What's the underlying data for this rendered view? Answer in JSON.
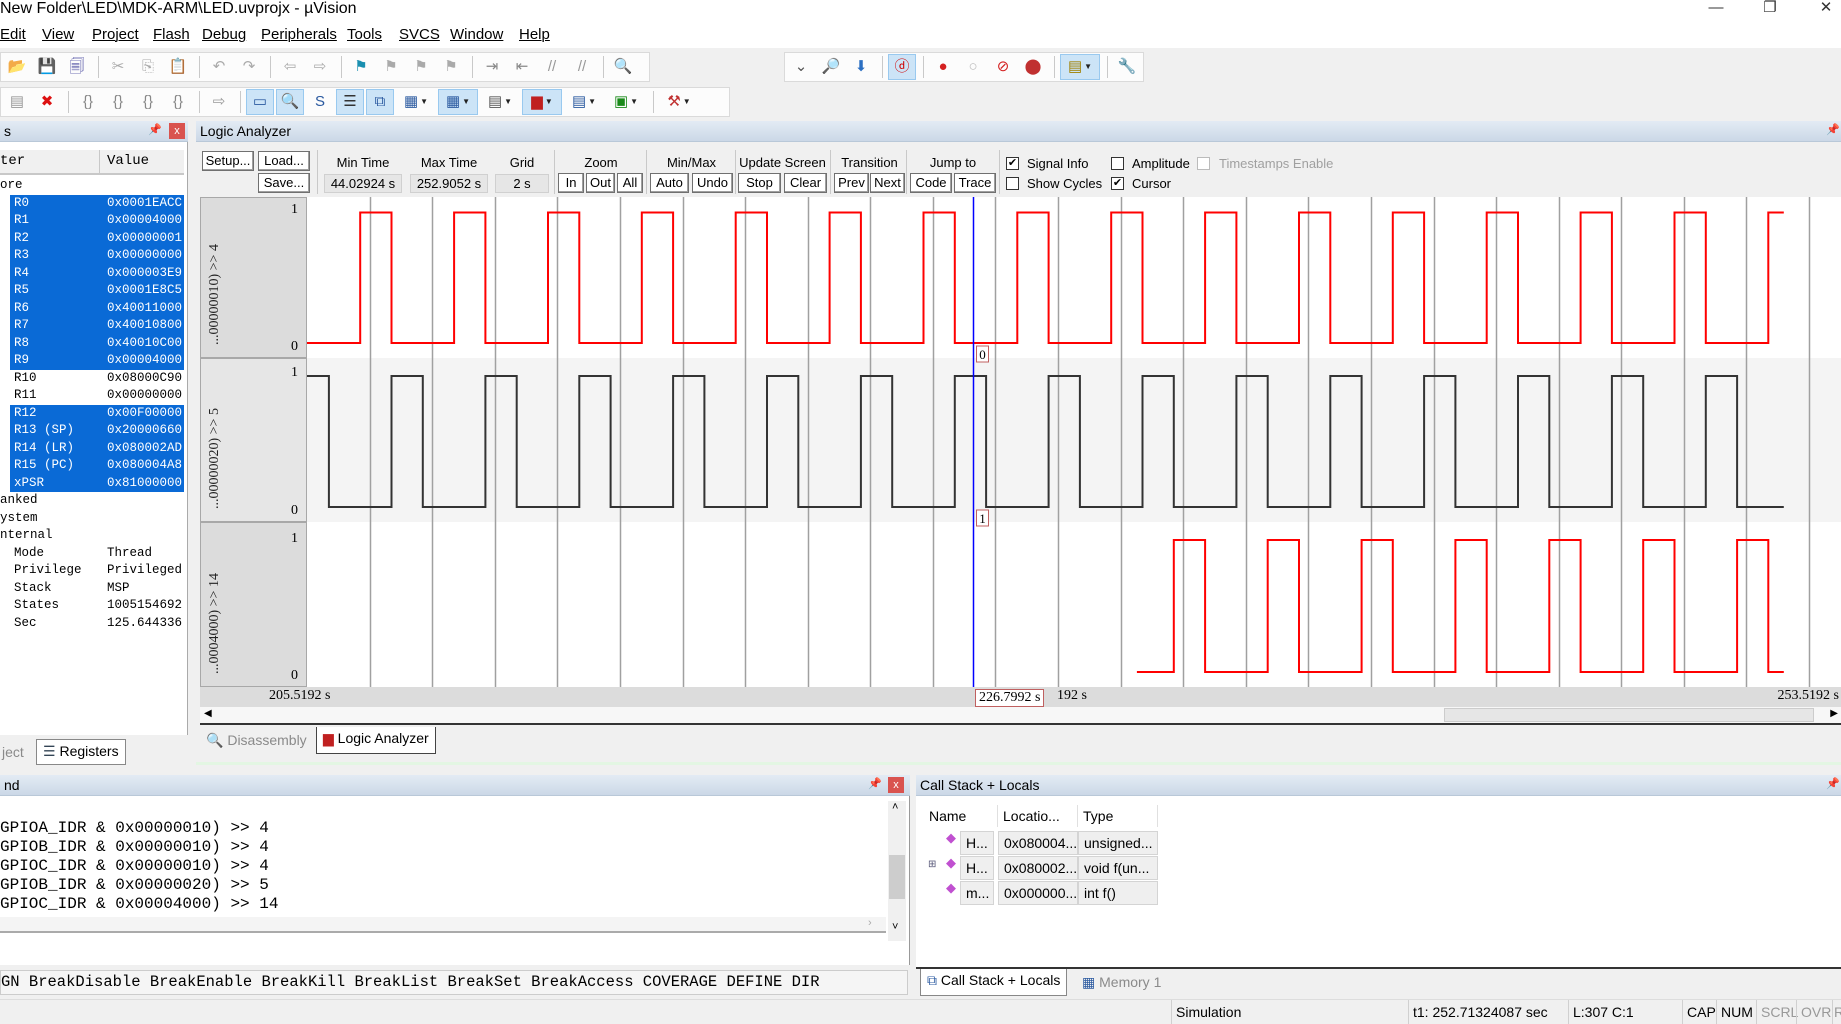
{
  "window": {
    "title": "New Folder\\LED\\MDK-ARM\\LED.uvprojx - µVision",
    "controls": [
      "—",
      "❐",
      "✕"
    ]
  },
  "menu": [
    "Edit",
    "View",
    "Project",
    "Flash",
    "Debug",
    "Peripherals",
    "Tools",
    "SVCS",
    "Window",
    "Help"
  ],
  "toolbar1": [
    {
      "name": "open-icon",
      "glyph": "📂",
      "color": "#d9a400"
    },
    {
      "name": "save-icon",
      "glyph": "💾",
      "color": "#2a55a6"
    },
    {
      "name": "save-all-icon",
      "glyph": "🗐",
      "color": "#4a4aa0"
    },
    {
      "sep": true
    },
    {
      "name": "cut-icon",
      "glyph": "✂",
      "color": "#aaa"
    },
    {
      "name": "copy-icon",
      "glyph": "⎘",
      "color": "#aaa"
    },
    {
      "name": "paste-icon",
      "glyph": "📋",
      "color": "#b08000"
    },
    {
      "sep": true
    },
    {
      "name": "undo-icon",
      "glyph": "↶",
      "color": "#aaa"
    },
    {
      "name": "redo-icon",
      "glyph": "↷",
      "color": "#aaa"
    },
    {
      "sep": true
    },
    {
      "name": "navigate-back-icon",
      "glyph": "⇦",
      "color": "#aaa"
    },
    {
      "name": "navigate-forward-icon",
      "glyph": "⇨",
      "color": "#aaa"
    },
    {
      "sep": true
    },
    {
      "name": "bookmark-icon",
      "glyph": "⚑",
      "color": "#1a8fb0"
    },
    {
      "name": "prev-bookmark-icon",
      "glyph": "⚑",
      "color": "#aaa"
    },
    {
      "name": "next-bookmark-icon",
      "glyph": "⚑",
      "color": "#aaa"
    },
    {
      "name": "clear-bookmarks-icon",
      "glyph": "⚑",
      "color": "#aaa"
    },
    {
      "sep": true
    },
    {
      "name": "indent-icon",
      "glyph": "⇥",
      "color": "#888"
    },
    {
      "name": "unindent-icon",
      "glyph": "⇤",
      "color": "#888"
    },
    {
      "name": "comment-icon",
      "glyph": "//",
      "color": "#999"
    },
    {
      "name": "uncomment-icon",
      "glyph": "//",
      "color": "#999"
    },
    {
      "sep": true
    },
    {
      "name": "find-in-files-icon",
      "glyph": "🔍",
      "color": "#c09000"
    }
  ],
  "toolbar1_right": [
    {
      "name": "find-combo-dropdown-icon",
      "glyph": "⌄",
      "color": "#555"
    },
    {
      "name": "find-icon",
      "glyph": "🔎",
      "color": "#335"
    },
    {
      "name": "incremental-find-icon",
      "glyph": "⬇",
      "color": "#2b6fc2"
    },
    {
      "sep": true
    },
    {
      "name": "start-stop-debug-icon",
      "glyph": "ⓓ",
      "color": "#d00000",
      "hl": true
    },
    {
      "sep": true
    },
    {
      "name": "insert-breakpoint-icon",
      "glyph": "●",
      "color": "#d42020"
    },
    {
      "name": "enable-breakpoint-icon",
      "glyph": "○",
      "color": "#bbb"
    },
    {
      "name": "disable-breakpoints-icon",
      "glyph": "⊘",
      "color": "#d42020"
    },
    {
      "name": "kill-breakpoints-icon",
      "glyph": "⬤",
      "color": "#c03030"
    },
    {
      "sep": true
    },
    {
      "name": "window-layout-icon",
      "glyph": "▤",
      "color": "#a08000",
      "hl": true,
      "dropdown": true
    },
    {
      "sep": true
    },
    {
      "name": "configure-icon",
      "glyph": "🔧",
      "color": "#3a6ea5"
    }
  ],
  "toolbar2": [
    {
      "name": "reset-icon",
      "glyph": "▤",
      "color": "#999"
    },
    {
      "name": "stop-icon",
      "glyph": "✖",
      "color": "#d11"
    },
    {
      "sep": true
    },
    {
      "name": "step-into-icon",
      "glyph": "{}",
      "color": "#888"
    },
    {
      "name": "step-over-icon",
      "glyph": "{}",
      "color": "#888"
    },
    {
      "name": "step-out-icon",
      "glyph": "{}",
      "color": "#888"
    },
    {
      "name": "run-to-cursor-icon",
      "glyph": "{}",
      "color": "#888"
    },
    {
      "sep": true
    },
    {
      "name": "show-next-statement-icon",
      "glyph": "⇨",
      "color": "#999"
    },
    {
      "sep": true
    },
    {
      "name": "command-window-icon",
      "glyph": "▭",
      "color": "#2b5aa0",
      "hl": true
    },
    {
      "name": "disassembly-window-icon",
      "glyph": "🔍",
      "color": "#333",
      "hl": true
    },
    {
      "name": "symbols-window-icon",
      "glyph": "S",
      "color": "#2b5aa0"
    },
    {
      "name": "registers-window-icon",
      "glyph": "☰",
      "color": "#333",
      "hl": true
    },
    {
      "name": "call-stack-window-icon",
      "glyph": "⧉",
      "color": "#2b5aa0",
      "hl": true
    },
    {
      "name": "watch-windows-icon",
      "glyph": "▦",
      "color": "#2b5aa0",
      "dropdown": true
    },
    {
      "name": "memory-windows-icon",
      "glyph": "▦",
      "color": "#2b5aa0",
      "hl": true,
      "dropdown": true
    },
    {
      "name": "serial-windows-icon",
      "glyph": "▤",
      "color": "#555",
      "dropdown": true
    },
    {
      "name": "analysis-windows-icon",
      "glyph": "▆",
      "color": "#c02020",
      "hl": true,
      "dropdown": true
    },
    {
      "name": "trace-windows-icon",
      "glyph": "▤",
      "color": "#2b5aa0",
      "dropdown": true
    },
    {
      "name": "system-viewer-icon",
      "glyph": "▣",
      "color": "#1a8a1a",
      "dropdown": true
    },
    {
      "sep": true
    },
    {
      "name": "toolbox-icon",
      "glyph": "⚒",
      "color": "#c03030",
      "dropdown": true
    }
  ],
  "registers": {
    "title": "s",
    "col_name": "ter",
    "col_value": "Value",
    "rows": [
      {
        "name": "ore",
        "value": "",
        "level": 0
      },
      {
        "name": "R0",
        "value": "0x0001EACC",
        "level": 1,
        "hl": true
      },
      {
        "name": "R1",
        "value": "0x00004000",
        "level": 1,
        "hl": true
      },
      {
        "name": "R2",
        "value": "0x00000001",
        "level": 1,
        "hl": true
      },
      {
        "name": "R3",
        "value": "0x00000000",
        "level": 1,
        "hl": true
      },
      {
        "name": "R4",
        "value": "0x000003E9",
        "level": 1,
        "hl": true
      },
      {
        "name": "R5",
        "value": "0x0001E8C5",
        "level": 1,
        "hl": true
      },
      {
        "name": "R6",
        "value": "0x40011000",
        "level": 1,
        "hl": true
      },
      {
        "name": "R7",
        "value": "0x40010800",
        "level": 1,
        "hl": true
      },
      {
        "name": "R8",
        "value": "0x40010C00",
        "level": 1,
        "hl": true
      },
      {
        "name": "R9",
        "value": "0x00004000",
        "level": 1,
        "hl": true
      },
      {
        "name": "R10",
        "value": "0x08000C90",
        "level": 1
      },
      {
        "name": "R11",
        "value": "0x00000000",
        "level": 1
      },
      {
        "name": "R12",
        "value": "0x00F00000",
        "level": 1,
        "hl": true
      },
      {
        "name": "R13 (SP)",
        "value": "0x20000660",
        "level": 1,
        "hl": true
      },
      {
        "name": "R14 (LR)",
        "value": "0x080002AD",
        "level": 1,
        "hl": true
      },
      {
        "name": "R15 (PC)",
        "value": "0x080004A8",
        "level": 1,
        "hl": true
      },
      {
        "name": "xPSR",
        "value": "0x81000000",
        "level": 1,
        "hl": true
      },
      {
        "name": "anked",
        "value": "",
        "level": 0
      },
      {
        "name": "ystem",
        "value": "",
        "level": 0
      },
      {
        "name": "nternal",
        "value": "",
        "level": 0
      },
      {
        "name": "Mode",
        "value": "Thread",
        "level": 1
      },
      {
        "name": "Privilege",
        "value": "Privileged",
        "level": 1
      },
      {
        "name": "Stack",
        "value": "MSP",
        "level": 1
      },
      {
        "name": "States",
        "value": "1005154692",
        "level": 1
      },
      {
        "name": "Sec",
        "value": "125.644336",
        "level": 1
      }
    ],
    "tabs": [
      {
        "label": "ject"
      },
      {
        "label": "Registers",
        "icon": "registers-icon"
      }
    ]
  },
  "logic_analyzer": {
    "title": "Logic Analyzer",
    "setup": "Setup...",
    "load": "Load...",
    "save": "Save...",
    "min_time_label": "Min Time",
    "min_time": "44.02924 s",
    "max_time_label": "Max Time",
    "max_time": "252.9052 s",
    "grid_label": "Grid",
    "grid": "2 s",
    "zoom_label": "Zoom",
    "zoom_in": "In",
    "zoom_out": "Out",
    "zoom_all": "All",
    "minmax_label": "Min/Max",
    "auto": "Auto",
    "undo": "Undo",
    "update_label": "Update Screen",
    "stop": "Stop",
    "clear": "Clear",
    "transition_label": "Transition",
    "prev": "Prev",
    "next": "Next",
    "jump_label": "Jump to",
    "code": "Code",
    "trace": "Trace",
    "signal_info": {
      "label": "Signal Info",
      "checked": true
    },
    "show_cycles": {
      "label": "Show Cycles",
      "checked": false
    },
    "amplitude": {
      "label": "Amplitude",
      "checked": false
    },
    "cursor": {
      "label": "Cursor",
      "checked": true
    },
    "timestamps": {
      "label": "Timestamps Enable",
      "checked": false,
      "disabled": true
    },
    "time_left": "205.5192 s",
    "time_right": "253.5192 s",
    "cursor_time": "226.7992 s",
    "hidden_time_tail": "192 s",
    "tabs": [
      {
        "label": "Disassembly",
        "icon": "disassembly-icon"
      },
      {
        "label": "Logic Analyzer",
        "icon": "logic-analyzer-icon"
      }
    ]
  },
  "chart_data": {
    "type": "line",
    "xlim": [
      205.5192,
      253.5192
    ],
    "grid_step": 2,
    "grid": true,
    "cursor": 226.7992,
    "signals": [
      {
        "label": "...00000010) >> 4",
        "color": "#ff0000",
        "ymax": "1",
        "ymin": "0",
        "cursor_value": "0",
        "start": 205.5192,
        "end": 252.7132,
        "high_intervals": [
          [
            207.22,
            208.22
          ],
          [
            210.22,
            211.22
          ],
          [
            213.22,
            214.22
          ],
          [
            216.22,
            217.22
          ],
          [
            219.22,
            220.22
          ],
          [
            222.22,
            223.22
          ],
          [
            225.22,
            226.22
          ],
          [
            228.22,
            229.22
          ],
          [
            231.22,
            232.22
          ],
          [
            234.22,
            235.22
          ],
          [
            237.22,
            238.22
          ],
          [
            240.22,
            241.22
          ],
          [
            243.22,
            244.22
          ],
          [
            246.22,
            247.22
          ],
          [
            249.22,
            250.22
          ],
          [
            252.22,
            252.7132
          ]
        ]
      },
      {
        "label": "...00000020) >> 5",
        "color": "#333333",
        "ymax": "1",
        "ymin": "0",
        "cursor_value": "1",
        "start": 205.5192,
        "end": 252.7132,
        "high_intervals": [
          [
            205.5192,
            206.22
          ],
          [
            208.22,
            209.22
          ],
          [
            211.22,
            212.22
          ],
          [
            214.22,
            215.22
          ],
          [
            217.22,
            218.22
          ],
          [
            220.22,
            221.22
          ],
          [
            223.22,
            224.22
          ],
          [
            226.22,
            227.22
          ],
          [
            229.22,
            230.22
          ],
          [
            232.22,
            233.22
          ],
          [
            235.22,
            236.22
          ],
          [
            238.22,
            239.22
          ],
          [
            241.22,
            242.22
          ],
          [
            244.22,
            245.22
          ],
          [
            247.22,
            248.22
          ],
          [
            250.22,
            251.22
          ]
        ]
      },
      {
        "label": "...0004000) >> 14",
        "color": "#ff0000",
        "ymax": "1",
        "ymin": "0",
        "start": 232.04,
        "end": 252.7132,
        "high_intervals": [
          [
            233.22,
            234.22
          ],
          [
            236.22,
            237.22
          ],
          [
            239.22,
            240.22
          ],
          [
            242.22,
            243.22
          ],
          [
            245.22,
            246.22
          ],
          [
            248.22,
            249.22
          ],
          [
            251.22,
            252.22
          ]
        ]
      }
    ]
  },
  "command": {
    "title": "nd",
    "lines": [
      "GPIOA_IDR & 0x00000010) >> 4",
      "GPIOB_IDR & 0x00000010) >> 4",
      "GPIOC_IDR & 0x00000010) >> 4",
      "GPIOB_IDR & 0x00000020) >> 5",
      "GPIOC_IDR & 0x00004000) >> 14"
    ],
    "hint": "GN BreakDisable BreakEnable BreakKill BreakList BreakSet BreakAccess COVERAGE DEFINE DIR"
  },
  "callstack": {
    "title": "Call Stack + Locals",
    "columns": [
      "Name",
      "Locatio...",
      "Type"
    ],
    "rows": [
      {
        "name": "H...",
        "location": "0x080004...",
        "type": "unsigned..."
      },
      {
        "name": "H...",
        "location": "0x080002...",
        "type": "void f(un...",
        "expandable": true
      },
      {
        "name": "m...",
        "location": "0x000000...",
        "type": "int f()"
      }
    ],
    "tabs": [
      {
        "label": "Call Stack + Locals",
        "icon": "call-stack-icon"
      },
      {
        "label": "Memory 1",
        "icon": "memory-icon"
      }
    ]
  },
  "statusbar": {
    "mode": "Simulation",
    "time": "t1: 252.71324087 sec",
    "position": "L:307 C:1",
    "cap": "CAP",
    "num": "NUM",
    "scrl": "SCRL",
    "ovr": "OVR",
    "r": "R"
  }
}
